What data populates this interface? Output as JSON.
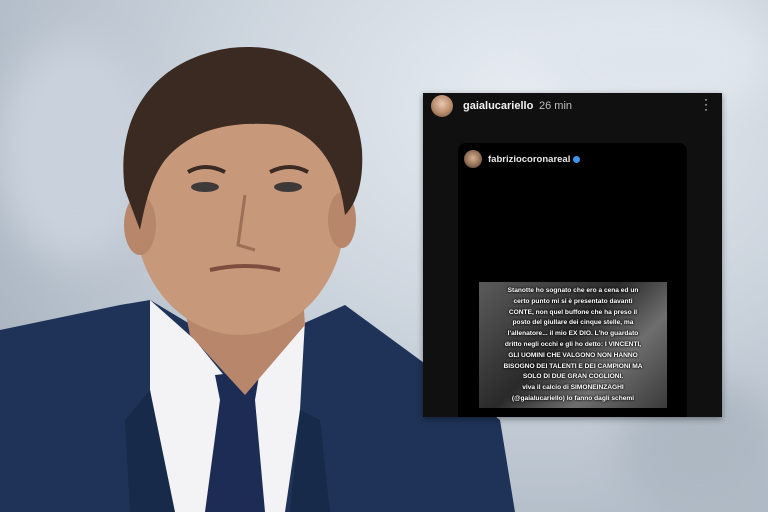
{
  "story": {
    "username": "gaialucariello",
    "time": "26 min",
    "reposted_username": "fabriziocoronareal",
    "caption_lines": [
      "Stanotte ho sognato che ero a cena ed un",
      "certo punto mi si è presentato davanti",
      "CONTE, non quel buffone che ha preso il",
      "posto del giullare dei cinque stelle, ma",
      "l'allenatore... il mio EX DIO. L'ho guardato",
      "dritto negli occhi e gli ho detto: I VINCENTI,",
      "GLI UOMINI CHE VALGONO NON HANNO",
      "BISOGNO DEI TALENTI E DEI CAMPIONI MA",
      "SOLO DI DUE GRAN COGLIONI.",
      "viva il calcio di SIMONEINZAGHI",
      "(@gaialucariello) lo fanno dagli schemi"
    ]
  },
  "colors": {
    "suit": "#1f3358",
    "shirt": "#f3f3f5",
    "tie": "#1c2c55",
    "hair": "#3a2a22",
    "skin": "#c8987a",
    "verified": "#3897f0"
  }
}
